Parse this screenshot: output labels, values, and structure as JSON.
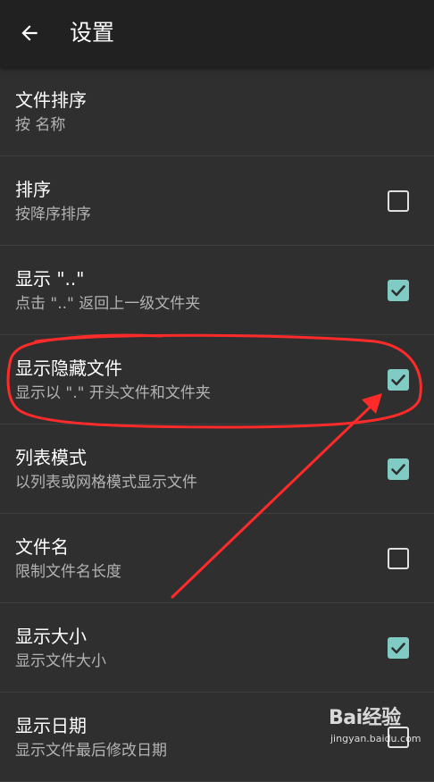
{
  "appbar": {
    "title": "设置"
  },
  "settings": [
    {
      "title": "文件排序",
      "subtitle": "按 名称"
    },
    {
      "title": "排序",
      "subtitle": "按降序排序",
      "checked": false
    },
    {
      "title": "显示 \"..\"",
      "subtitle": "点击 \"..\" 返回上一级文件夹",
      "checked": true
    },
    {
      "title": "显示隐藏文件",
      "subtitle": "显示以 \".\" 开头文件和文件夹",
      "checked": true
    },
    {
      "title": "列表模式",
      "subtitle": "以列表或网格模式显示文件",
      "checked": true
    },
    {
      "title": "文件名",
      "subtitle": "限制文件名长度",
      "checked": false
    },
    {
      "title": "显示大小",
      "subtitle": "显示文件大小",
      "checked": true
    },
    {
      "title": "显示日期",
      "subtitle": "显示文件最后修改日期",
      "checked": false
    }
  ],
  "colors": {
    "background": "#2f2f2f",
    "appbar": "#212121",
    "checkbox_on": "#80cbc4",
    "annotation": "#ff2a2a"
  },
  "watermark": {
    "logo_text": "Bai经验",
    "url": "jingyan.baidu.com"
  }
}
